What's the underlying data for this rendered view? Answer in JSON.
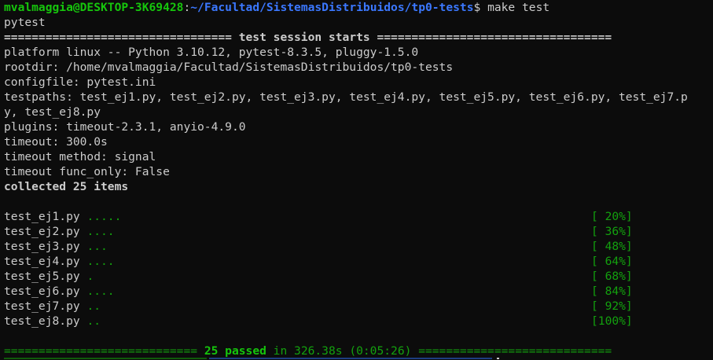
{
  "prompt": {
    "user_host": "mvalmaggia@DESKTOP-3K69428",
    "separator": ":",
    "path": "~/Facultad/SistemasDistribuidos/tp0-tests",
    "symbol": "$ ",
    "command": "make test"
  },
  "lines": {
    "pytest": "pytest",
    "session_start_left": "================================= ",
    "session_start_title": "test session starts",
    "session_start_right": " ==================================",
    "platform": "platform linux -- Python 3.10.12, pytest-8.3.5, pluggy-1.5.0",
    "rootdir": "rootdir: /home/mvalmaggia/Facultad/SistemasDistribuidos/tp0-tests",
    "configfile": "configfile: pytest.ini",
    "testpaths_1": "testpaths: test_ej1.py, test_ej2.py, test_ej3.py, test_ej4.py, test_ej5.py, test_ej6.py, test_ej7.p",
    "testpaths_2": "y, test_ej8.py",
    "plugins": "plugins: timeout-2.3.1, anyio-4.9.0",
    "timeout": "timeout: 300.0s",
    "timeout_method": "timeout method: signal",
    "timeout_func_only": "timeout func_only: False",
    "collected": "collected 25 items"
  },
  "results": [
    {
      "file": "test_ej1.py",
      "dots": ".....",
      "progress": "[ 20%]"
    },
    {
      "file": "test_ej2.py",
      "dots": "....",
      "progress": "[ 36%]"
    },
    {
      "file": "test_ej3.py",
      "dots": "...",
      "progress": "[ 48%]"
    },
    {
      "file": "test_ej4.py",
      "dots": "....",
      "progress": "[ 64%]"
    },
    {
      "file": "test_ej5.py",
      "dots": ".",
      "progress": "[ 68%]"
    },
    {
      "file": "test_ej6.py",
      "dots": "....",
      "progress": "[ 84%]"
    },
    {
      "file": "test_ej7.py",
      "dots": "..",
      "progress": "[ 92%]"
    },
    {
      "file": "test_ej8.py",
      "dots": "..",
      "progress": "[100%]"
    }
  ],
  "summary": {
    "left_rule": "============================ ",
    "passed": "25 passed",
    "timing": " in 326.38s (0:05:26) ",
    "right_rule": "============================"
  },
  "colors": {
    "background": "#0c0c0c",
    "foreground": "#cccccc",
    "prompt_user": "#16c60c",
    "prompt_path": "#3b78ff",
    "dots": "#13a10e"
  }
}
